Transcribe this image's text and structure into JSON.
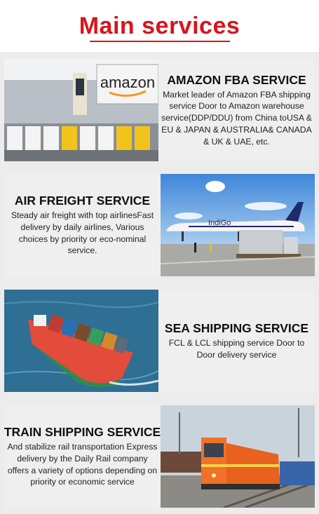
{
  "header": {
    "title": "Main services"
  },
  "services": [
    {
      "title": "AMAZON FBA SERVICE",
      "description": "Market leader of Amazon FBA shipping service Door to Amazon warehouse service(DDP/DDU) from China toUSA & EU & JAPAN & AUSTRALIA& CANADA & UK & UAE, etc.",
      "image_text": "amazon"
    },
    {
      "title": "AIR FREIGHT SERVICE",
      "description": "Steady air freight with top airlinesFast delivery by daily airlines, Various choices by priority or eco-nominal service.",
      "image_text": "IndiGo"
    },
    {
      "title": "SEA SHIPPING SERVICE",
      "description": "FCL & LCL shipping service Door to Door delivery service"
    },
    {
      "title": "TRAIN SHIPPING SERVICE",
      "description": "And stabilize rail transportation Express delivery by the Daily Rail company offers a variety of options depending on priority or economic service"
    }
  ],
  "colors": {
    "accent": "#d8141c",
    "card_bg": "#efefef",
    "page_bg": "#ececec"
  }
}
